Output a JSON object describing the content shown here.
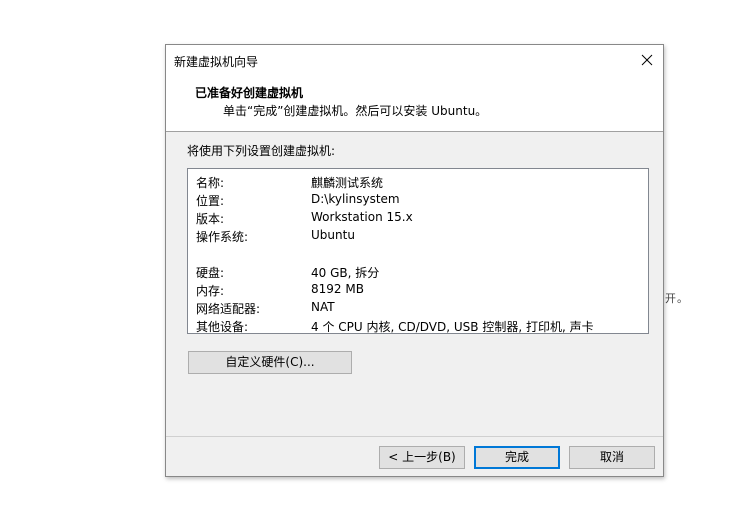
{
  "background_fragment": "开。",
  "dialog": {
    "title": "新建虚拟机向导",
    "header_title": "已准备好创建虚拟机",
    "header_subtitle": "单击“完成”创建虚拟机。然后可以安装 Ubuntu。",
    "intro": "将使用下列设置创建虚拟机:",
    "settings": [
      {
        "key": "名称:",
        "value": "麒麟测试系统"
      },
      {
        "key": "位置:",
        "value": "D:\\kylinsystem"
      },
      {
        "key": "版本:",
        "value": "Workstation 15.x"
      },
      {
        "key": "操作系统:",
        "value": "Ubuntu"
      },
      {
        "key": "硬盘:",
        "value": "40 GB, 拆分"
      },
      {
        "key": "内存:",
        "value": "8192 MB"
      },
      {
        "key": "网络适配器:",
        "value": "NAT"
      },
      {
        "key": "其他设备:",
        "value": "4 个 CPU 内核, CD/DVD, USB 控制器, 打印机, 声卡"
      }
    ],
    "customize_button": "自定义硬件(C)...",
    "back_button": "< 上一步(B)",
    "finish_button": "完成",
    "cancel_button": "取消"
  },
  "icons": {
    "close": "close-icon"
  }
}
